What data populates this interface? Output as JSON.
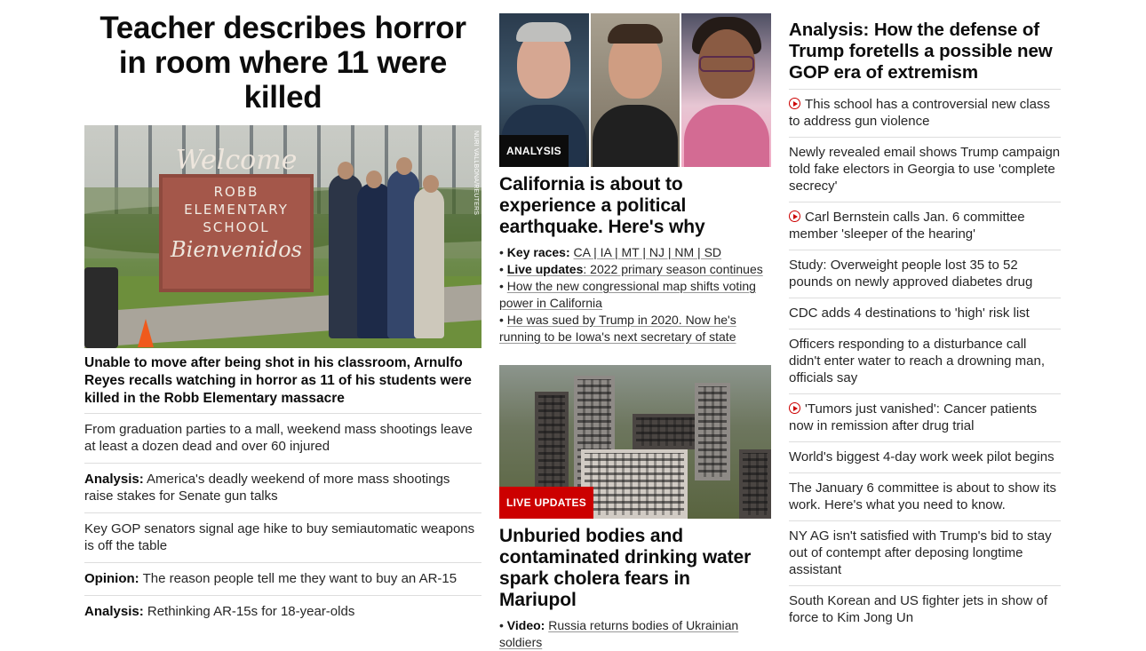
{
  "left": {
    "hero_title": "Teacher describes horror in room where 11 were killed",
    "photo": {
      "sign_line1": "Welcome",
      "sign_line2": "ROBB",
      "sign_line3": "ELEMENTARY",
      "sign_line4": "SCHOOL",
      "sign_line5": "Bienvenidos",
      "credit": "NURI VALLBONA/REUTERS"
    },
    "hero_description": "Unable to move after being shot in his classroom, Arnulfo Reyes recalls watching in horror as 11 of his students were killed in the Robb Elementary massacre",
    "items": [
      {
        "prefix": "",
        "text": "From graduation parties to a mall, weekend mass shootings leave at least a dozen dead and over 60 injured"
      },
      {
        "prefix": "Analysis:",
        "text": "America's deadly weekend of more mass shootings raise stakes for Senate gun talks"
      },
      {
        "prefix": "",
        "text": "Key GOP senators signal age hike to buy semiautomatic weapons is off the table"
      },
      {
        "prefix": "Opinion:",
        "text": "The reason people tell me they want to buy an AR-15"
      },
      {
        "prefix": "Analysis:",
        "text": "Rethinking AR-15s for 18-year-olds"
      }
    ]
  },
  "middle": {
    "story1": {
      "badge": "ANALYSIS",
      "title": "California is about to experience a political earthquake. Here's why",
      "key_races_label": "Key races:",
      "key_races": "CA | IA | MT | NJ | NM | SD",
      "live_label": "Live updates",
      "live_text": ": 2022 primary season continues",
      "bullet3": "How the new congressional map shifts voting power in California",
      "bullet4": "He was sued by Trump in 2020. Now he's running to be Iowa's next secretary of state"
    },
    "story2": {
      "badge": "LIVE UPDATES",
      "title": "Unburied bodies and contaminated drinking water spark cholera fears in Mariupol",
      "video_label": "Video:",
      "video_text": "Russia returns bodies of Ukrainian soldiers"
    }
  },
  "right": {
    "title": "Analysis: How the defense of Trump foretells a possible new GOP era of extremism",
    "items": [
      {
        "video": true,
        "text": "This school has a controversial new class to address gun violence"
      },
      {
        "video": false,
        "text": "Newly revealed email shows Trump campaign told fake electors in Georgia to use 'complete secrecy'"
      },
      {
        "video": true,
        "text": "Carl Bernstein calls Jan. 6 committee member 'sleeper of the hearing'"
      },
      {
        "video": false,
        "text": "Study: Overweight people lost 35 to 52 pounds on newly approved diabetes drug"
      },
      {
        "video": false,
        "text": "CDC adds 4 destinations to 'high' risk list"
      },
      {
        "video": false,
        "text": "Officers responding to a disturbance call didn't enter water to reach a drowning man, officials say"
      },
      {
        "video": true,
        "text": "'Tumors just vanished': Cancer patients now in remission after drug trial"
      },
      {
        "video": false,
        "text": "World's biggest 4-day work week pilot begins"
      },
      {
        "video": false,
        "text": "The January 6 committee is about to show its work. Here's what you need to know."
      },
      {
        "video": false,
        "text": "NY AG isn't satisfied with Trump's bid to stay out of contempt after deposing longtime assistant"
      },
      {
        "video": false,
        "text": "South Korean and US fighter jets in show of force to Kim Jong Un"
      }
    ]
  },
  "colors": {
    "text": "#0c0c0c",
    "secondary_text": "#262626",
    "divider": "#dddddd",
    "live_badge": "#cc0000",
    "analysis_badge": "#0c0c0c",
    "video_icon": "#cc0000"
  }
}
